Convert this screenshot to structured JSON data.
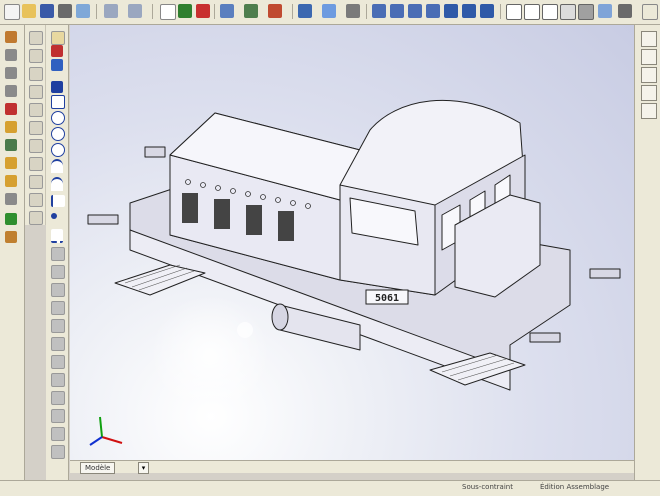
{
  "viewport": {
    "model_plate_text": "5061",
    "cab_plate_text": "5061"
  },
  "tabs": {
    "active_label": "Modèle",
    "arrow_label": "▾"
  },
  "status": {
    "left_text": "Sous-contraint",
    "right_text": "Édition Assemblage"
  },
  "colors": {
    "toolbar_bg": "#ece9d8",
    "model_fill": "#e6e6ef",
    "model_stroke": "#222222",
    "axis_x": "#d01010",
    "axis_y": "#10a010",
    "axis_z": "#1030d0"
  },
  "icons": [
    "new-file-icon",
    "open-file-icon",
    "save-icon",
    "print-icon",
    "undo-icon",
    "redo-icon",
    "select-icon",
    "rebuild-icon",
    "options-icon",
    "zoom-fit-icon",
    "zoom-area-icon",
    "rotate-icon",
    "pan-icon",
    "view-orientation-icon",
    "sketch-line-icon",
    "sketch-circle-icon",
    "sketch-arc-icon",
    "triad-icon"
  ]
}
